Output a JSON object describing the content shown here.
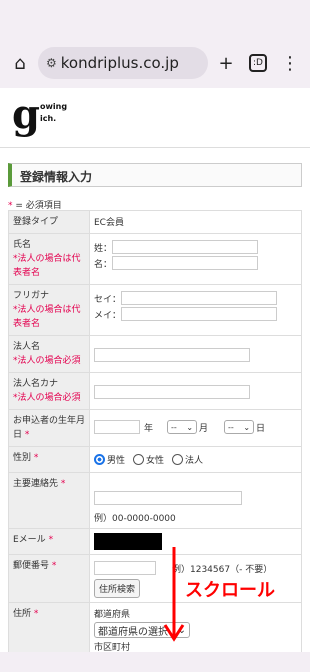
{
  "browser": {
    "url": "kondriplus.co.jp",
    "tab_count": ":D",
    "home_icon": "home-icon",
    "plus_icon": "plus-icon",
    "menu_icon": "more-vert-icon"
  },
  "logo": {
    "mark": "g",
    "line1": "owing",
    "line2": "ich."
  },
  "section_title": "登録情報入力",
  "required_note": {
    "star": "*",
    "text": " = 必須項目"
  },
  "form": {
    "type_label": "登録タイプ",
    "type_value": "EC会員",
    "name_label": "氏名",
    "name_note": "*法人の場合は代表者名",
    "last_name": "姓：",
    "first_name": "名：",
    "kana_label": "フリガナ",
    "kana_note": "*法人の場合は代表者名",
    "sei": "セイ：",
    "mei": "メイ：",
    "corp_label": "法人名",
    "corp_note": "*法人の場合必須",
    "corp_kana_label": "法人名カナ",
    "corp_kana_note": "*法人の場合必須",
    "birth_label": "お申込者の生年月日",
    "birth_star": "*",
    "year": "年",
    "month": "月",
    "day": "日",
    "month_select": "--",
    "day_select": "--",
    "gender_label": "性別",
    "gender_star": "*",
    "male": "男性",
    "female": "女性",
    "corporate": "法人",
    "contact_label": "主要連絡先",
    "contact_star": "*",
    "contact_example": "例）00-0000-0000",
    "email_label": "Eメール",
    "email_star": "*",
    "zip_label": "郵便番号",
    "zip_star": "*",
    "zip_example": "例）1234567（- 不要）",
    "zip_button": "住所検索",
    "address_label": "住所",
    "address_star": "*",
    "pref_label": "都道府県",
    "pref_select": "都道府県の選択",
    "city_label": "市区町村"
  },
  "annotation": {
    "text": "スクロール",
    "color": "#ff0000"
  },
  "colors": {
    "accent": "#5a9a3a",
    "required": "#e4004f"
  }
}
